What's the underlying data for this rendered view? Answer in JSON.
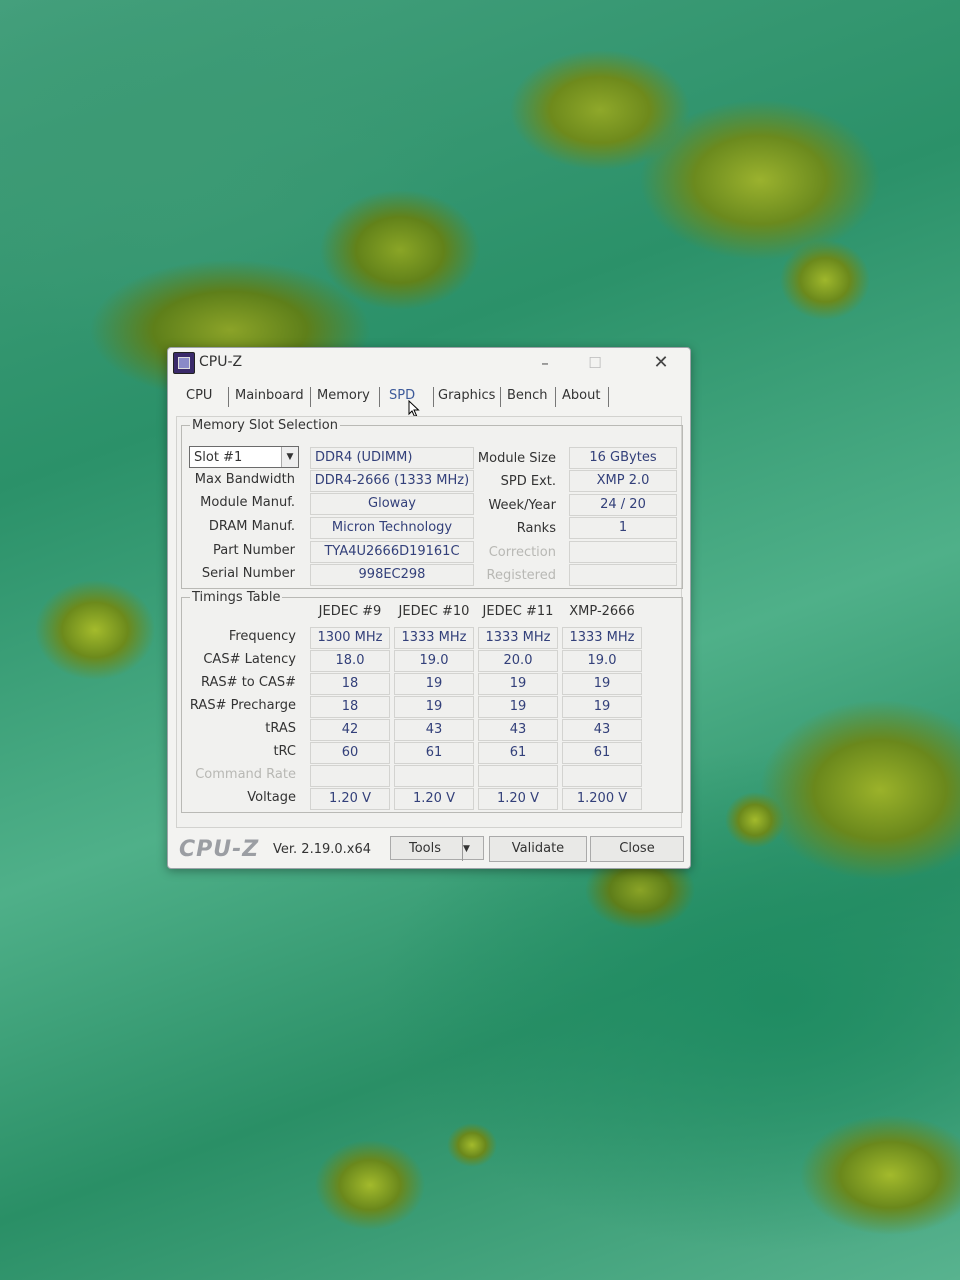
{
  "window": {
    "title": "CPU-Z",
    "minimize": "–",
    "maximize": "☐",
    "close": "✕"
  },
  "tabs": [
    "CPU",
    "Mainboard",
    "Memory",
    "SPD",
    "Graphics",
    "Bench",
    "About"
  ],
  "active_tab": "SPD",
  "slot_group": {
    "legend": "Memory Slot Selection",
    "slot_value": "Slot #1",
    "type": "DDR4 (UDIMM)",
    "labels": {
      "max_bandwidth": "Max Bandwidth",
      "module_manuf": "Module Manuf.",
      "dram_manuf": "DRAM Manuf.",
      "part_number": "Part Number",
      "serial_number": "Serial Number",
      "module_size": "Module Size",
      "spd_ext": "SPD Ext.",
      "week_year": "Week/Year",
      "ranks": "Ranks",
      "correction": "Correction",
      "registered": "Registered"
    },
    "values": {
      "max_bandwidth": "DDR4-2666 (1333 MHz)",
      "module_manuf": "Gloway",
      "dram_manuf": "Micron Technology",
      "part_number": "TYA4U2666D19161C",
      "serial_number": "998EC298",
      "module_size": "16 GBytes",
      "spd_ext": "XMP 2.0",
      "week_year": "24 / 20",
      "ranks": "1",
      "correction": "",
      "registered": ""
    }
  },
  "timings": {
    "legend": "Timings Table",
    "columns": [
      "JEDEC #9",
      "JEDEC #10",
      "JEDEC #11",
      "XMP-2666"
    ],
    "rows": [
      {
        "label": "Frequency",
        "values": [
          "1300 MHz",
          "1333 MHz",
          "1333 MHz",
          "1333 MHz"
        ]
      },
      {
        "label": "CAS# Latency",
        "values": [
          "18.0",
          "19.0",
          "20.0",
          "19.0"
        ]
      },
      {
        "label": "RAS# to CAS#",
        "values": [
          "18",
          "19",
          "19",
          "19"
        ]
      },
      {
        "label": "RAS# Precharge",
        "values": [
          "18",
          "19",
          "19",
          "19"
        ]
      },
      {
        "label": "tRAS",
        "values": [
          "42",
          "43",
          "43",
          "43"
        ]
      },
      {
        "label": "tRC",
        "values": [
          "60",
          "61",
          "61",
          "61"
        ]
      },
      {
        "label": "Command Rate",
        "values": [
          "",
          "",
          "",
          ""
        ]
      },
      {
        "label": "Voltage",
        "values": [
          "1.20 V",
          "1.20 V",
          "1.20 V",
          "1.200 V"
        ]
      }
    ]
  },
  "footer": {
    "brand": "CPU-Z",
    "version": "Ver. 2.19.0.x64",
    "tools": "Tools",
    "validate": "Validate",
    "close": "Close"
  }
}
